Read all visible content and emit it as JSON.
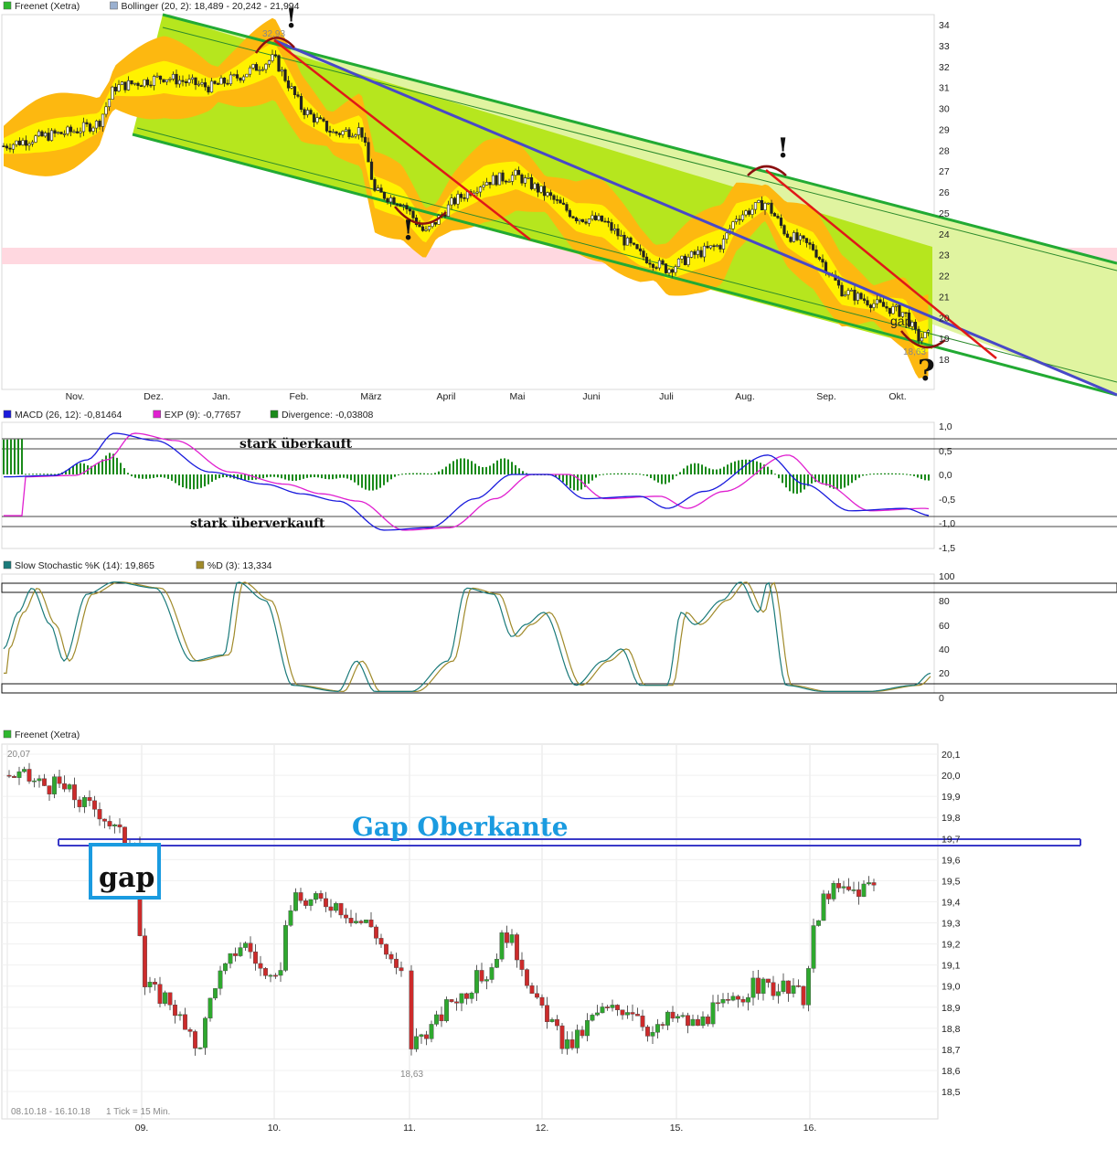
{
  "colors": {
    "channel_dark": "#22aa33",
    "channel_fill": "#b6e61e",
    "channel_light": "#e0f4a0",
    "bb_outer": "#fdb810",
    "bb_inner": "#fff200",
    "resistance_band": "#ffd8e0",
    "trend_red": "#e01818",
    "trend_blue": "#4848c8",
    "macd": "#1a1adc",
    "macd_signal": "#e020d0",
    "divergence": "#1a8a1a",
    "stoch_k": "#1a7a7a",
    "stoch_d": "#a08a2a",
    "candle_up": "#2ea82e",
    "candle_down": "#cc2b2b",
    "gap_line": "#3a3ac8",
    "gap_label": "#1a9be0"
  },
  "panel1": {
    "legend": [
      {
        "label": "Freenet (Xetra)",
        "color": "#2eb82e"
      },
      {
        "label": "Bollinger (20, 2): 18,489 - 20,242 - 21,994",
        "color": "#9ab0d0"
      }
    ],
    "y_ticks": [
      "34",
      "33",
      "32",
      "31",
      "30",
      "29",
      "28",
      "27",
      "26",
      "25",
      "24",
      "23",
      "22",
      "21",
      "20",
      "19",
      "18"
    ],
    "x_ticks": [
      "Nov.",
      "Dez.",
      "Jan.",
      "Feb.",
      "März",
      "April",
      "Mai",
      "Juni",
      "Juli",
      "Aug.",
      "Sep.",
      "Okt."
    ],
    "high_label": "32,93",
    "low_label": "18,63",
    "annotations": {
      "excl1": "!",
      "excl2": "!",
      "excl3": "!",
      "question": "?",
      "gap": "gap"
    }
  },
  "panel2": {
    "legend": [
      {
        "label": "MACD (26, 12): -0,81464",
        "color": "#1a1adc"
      },
      {
        "label": "EXP (9): -0,77657",
        "color": "#e020d0"
      },
      {
        "label": "Divergence: -0,03808",
        "color": "#1a8a1a"
      }
    ],
    "y_ticks": [
      "1,0",
      "0,5",
      "0,0",
      "-0,5",
      "-1,0",
      "-1,5"
    ],
    "overbought": "stark überkauft",
    "oversold": "stark überverkauft"
  },
  "panel3": {
    "legend": [
      {
        "label": "Slow Stochastic %K (14): 19,865",
        "color": "#1a7a7a"
      },
      {
        "label": "%D (3): 13,334",
        "color": "#a08a2a"
      }
    ],
    "y_ticks": [
      "100",
      "80",
      "60",
      "40",
      "20",
      "0"
    ]
  },
  "panel4": {
    "legend": [
      {
        "label": "Freenet (Xetra)",
        "color": "#2eb82e"
      }
    ],
    "y_ticks": [
      "20,1",
      "20,0",
      "19,9",
      "19,8",
      "19,7",
      "19,6",
      "19,5",
      "19,4",
      "19,3",
      "19,2",
      "19,1",
      "19,0",
      "18,9",
      "18,8",
      "18,7",
      "18,6",
      "18,5"
    ],
    "x_ticks": [
      "09.",
      "10.",
      "11.",
      "12.",
      "15.",
      "16."
    ],
    "high_label": "20,07",
    "low_label": "18,63",
    "gap_title": "Gap Oberkante",
    "gap_box": "gap",
    "footer_range": "08.10.18 - 16.10.18",
    "footer_tick": "1 Tick = 15 Min."
  },
  "chart_data": [
    {
      "type": "line",
      "title": "Freenet (Xetra)",
      "series": [
        {
          "name": "Freenet (Xetra)",
          "x": [
            "Okt.",
            "Nov.",
            "Dez.",
            "Jan.",
            "Feb.",
            "März",
            "April",
            "Mai",
            "Juni",
            "Juli",
            "Aug.",
            "Sep.",
            "Okt."
          ],
          "values": [
            28.2,
            28.6,
            31.2,
            31.5,
            32.2,
            28.5,
            23.8,
            26.8,
            25.0,
            22.0,
            25.8,
            21.0,
            18.9
          ]
        },
        {
          "name": "Bollinger (20, 2)",
          "values": [
            18.489,
            20.242,
            21.994
          ]
        }
      ],
      "high": 32.93,
      "low": 18.63,
      "ylim": [
        17.3,
        34.5
      ]
    },
    {
      "type": "line",
      "series": [
        {
          "name": "MACD (26, 12)",
          "last": -0.81464
        },
        {
          "name": "EXP (9)",
          "last": -0.77657
        },
        {
          "name": "Divergence",
          "last": -0.03808
        }
      ],
      "ylim": [
        -1.5,
        1.0
      ],
      "reference_lines": [
        0.75,
        -0.9
      ]
    },
    {
      "type": "line",
      "series": [
        {
          "name": "Slow Stochastic %K (14)",
          "last": 19.865
        },
        {
          "name": "%D (3)",
          "last": 13.334
        }
      ],
      "ylim": [
        0,
        100
      ],
      "reference_lines": [
        90,
        10
      ]
    },
    {
      "type": "line",
      "title": "Freenet (Xetra)",
      "x": [
        "08.10.",
        "09.",
        "10.",
        "11.",
        "12.",
        "15.",
        "16."
      ],
      "series": [
        {
          "name": "Freenet (Xetra)",
          "values": [
            20.0,
            19.72,
            18.95,
            19.4,
            18.75,
            19.25,
            18.9,
            19.0,
            19.5
          ]
        }
      ],
      "high": 20.07,
      "low": 18.63,
      "gap_upper_edge": 19.67,
      "ylim": [
        18.45,
        20.15
      ]
    }
  ]
}
